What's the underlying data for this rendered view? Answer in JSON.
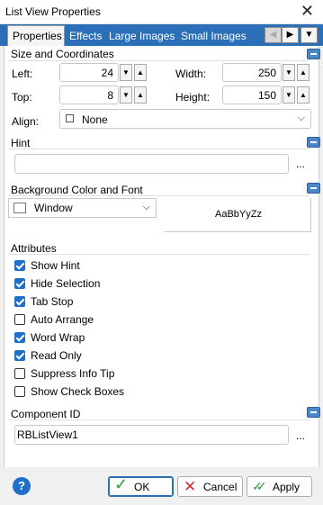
{
  "window": {
    "title": "List View Properties"
  },
  "tabs": [
    {
      "label": "Properties"
    },
    {
      "label": "Effects"
    },
    {
      "label": "Large Images"
    },
    {
      "label": "Small Images"
    }
  ],
  "size_section": {
    "title": "Size and Coordinates",
    "left_label": "Left:",
    "left_value": "24",
    "top_label": "Top:",
    "top_value": "8",
    "width_label": "Width:",
    "width_value": "250",
    "height_label": "Height:",
    "height_value": "150",
    "align_label": "Align:",
    "align_value": "None"
  },
  "hint_section": {
    "title": "Hint",
    "value": "",
    "browse": "..."
  },
  "background_section": {
    "title": "Background Color and Font",
    "color_value": "Window",
    "font_preview": "AaBbYyZz"
  },
  "attributes_section": {
    "title": "Attributes",
    "items": [
      {
        "label": "Show Hint",
        "checked": true
      },
      {
        "label": "Hide Selection",
        "checked": true
      },
      {
        "label": "Tab Stop",
        "checked": true
      },
      {
        "label": "Auto Arrange",
        "checked": false
      },
      {
        "label": "Word Wrap",
        "checked": true
      },
      {
        "label": "Read Only",
        "checked": true
      },
      {
        "label": "Suppress Info Tip",
        "checked": false
      },
      {
        "label": "Show Check Boxes",
        "checked": false
      }
    ]
  },
  "component_section": {
    "title": "Component ID",
    "value": "RBListView1",
    "browse": "..."
  },
  "footer": {
    "help": "?",
    "ok_label": "OK",
    "cancel_label": "Cancel",
    "apply_label": "Apply"
  },
  "colors": {
    "accent": "#2b6fb8",
    "check": "#1f6fc8",
    "ok_green": "#2a9d3a",
    "cancel_red": "#d23030"
  }
}
